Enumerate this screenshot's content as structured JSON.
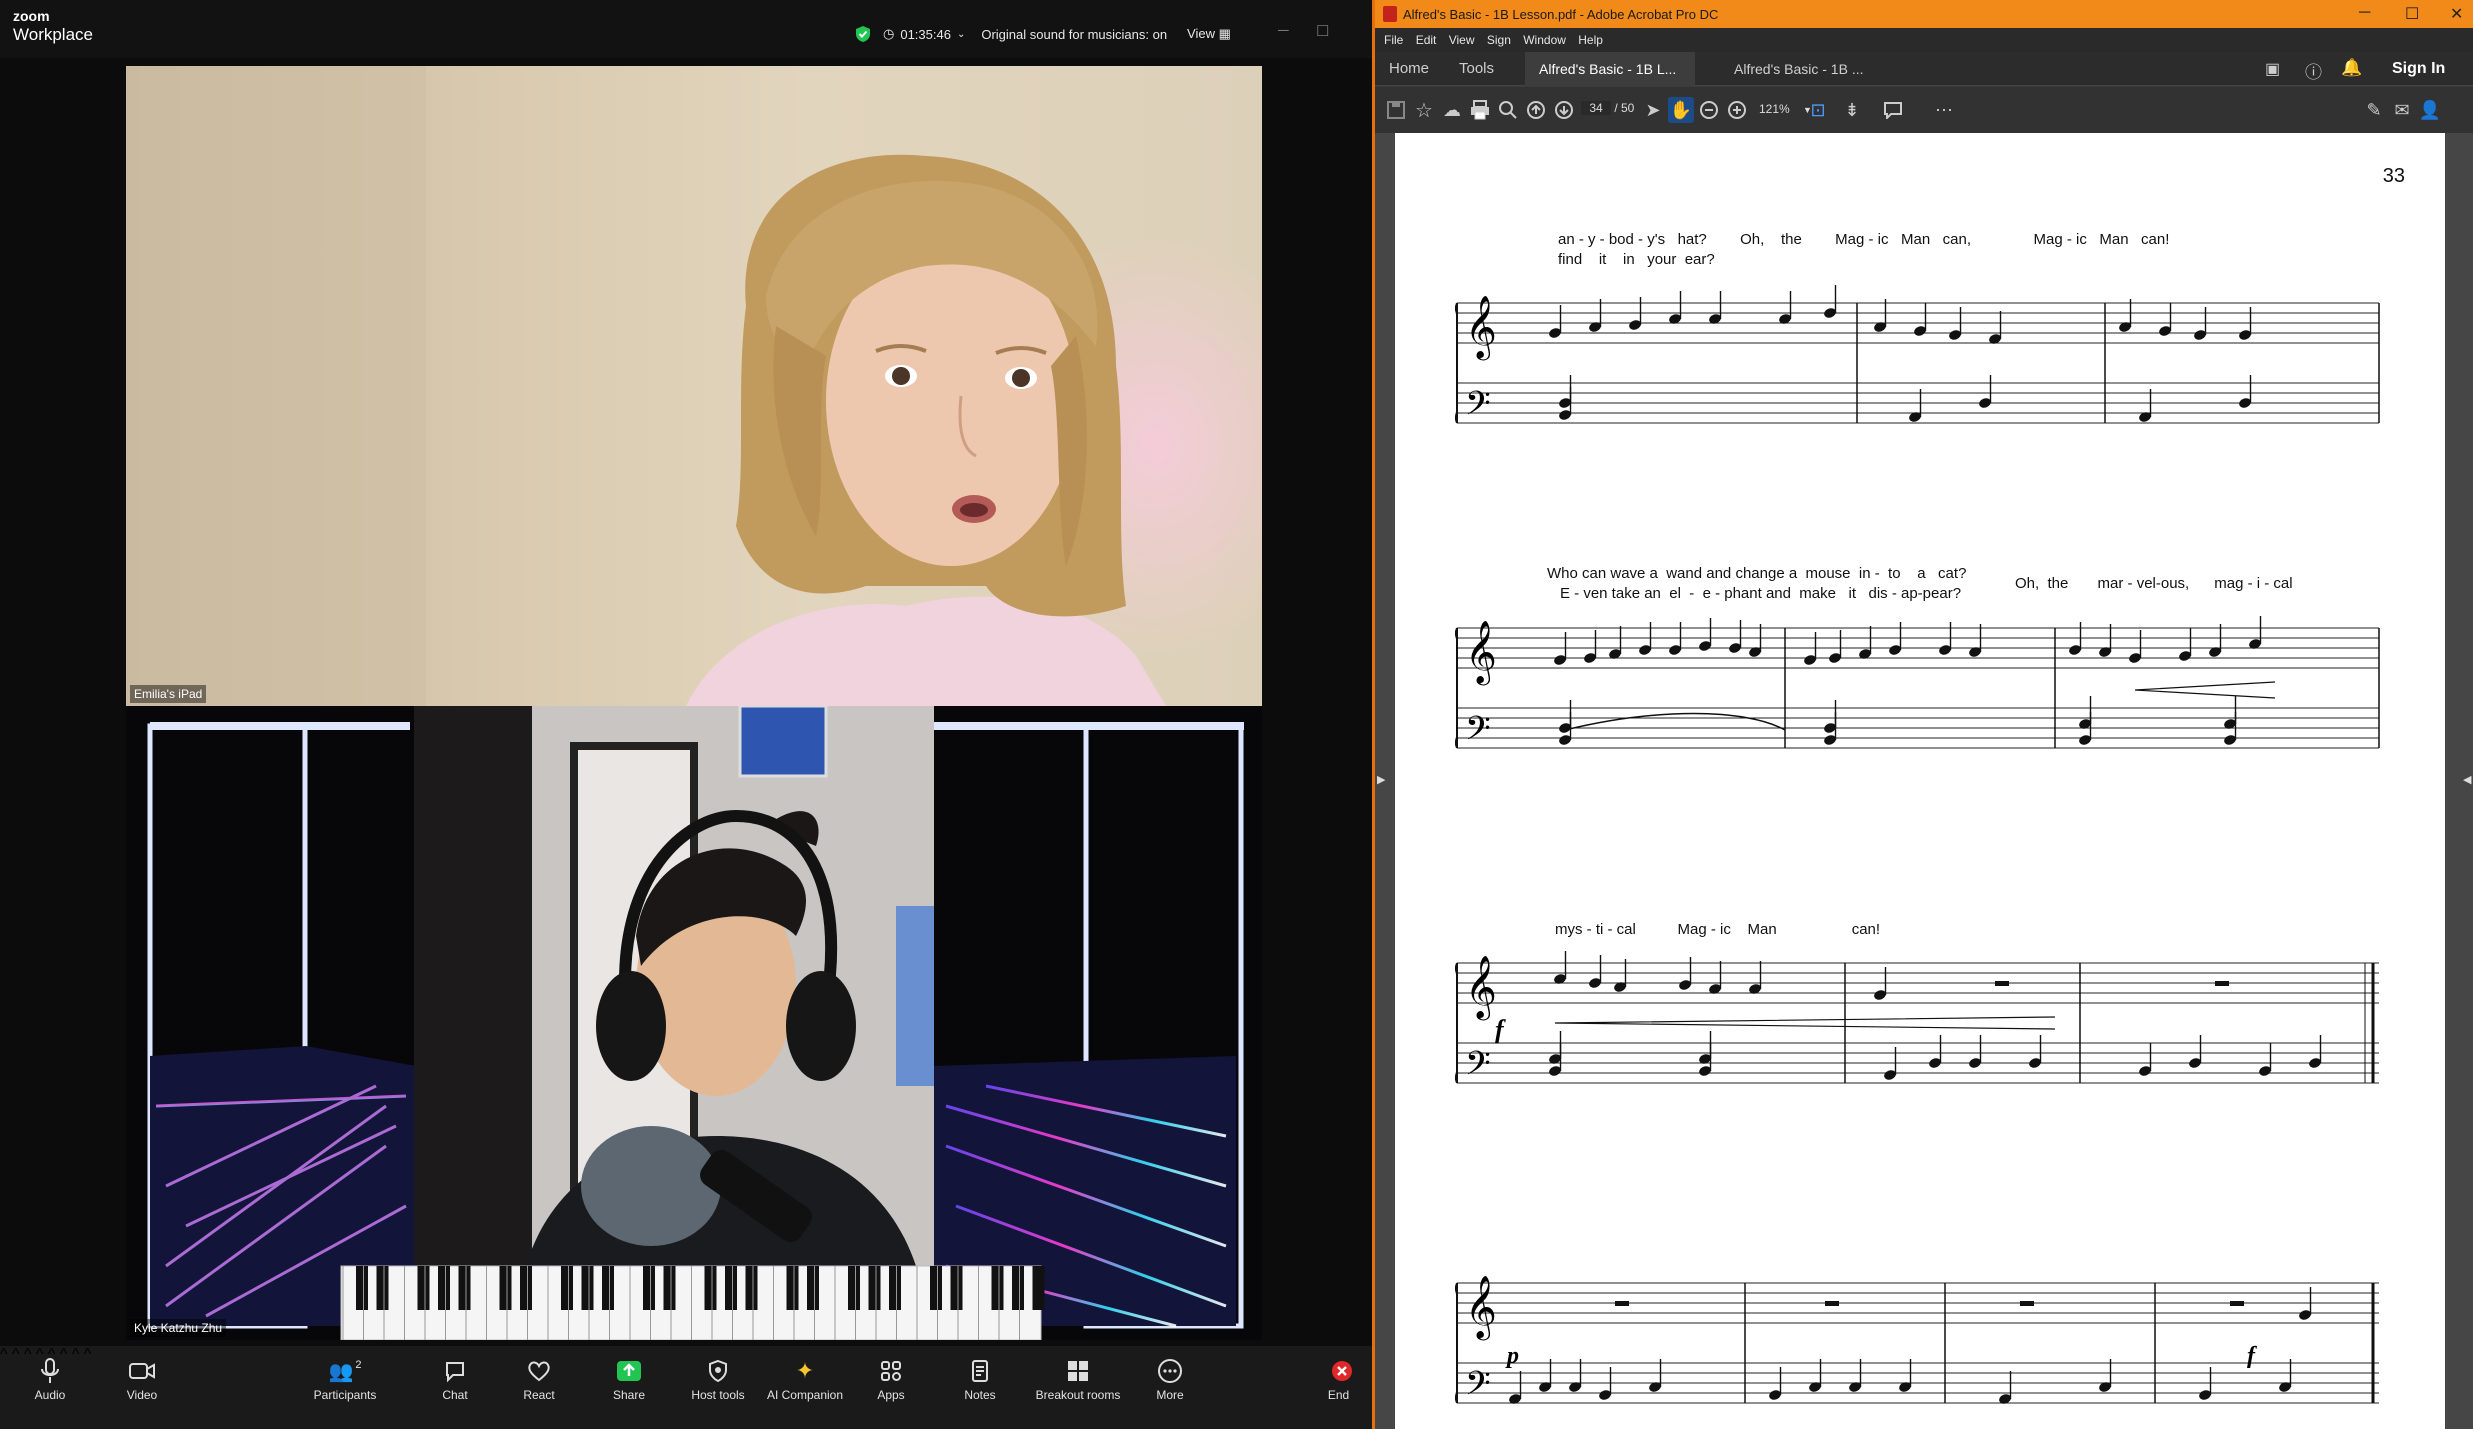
{
  "zoom": {
    "logo_top": "zoom",
    "logo_bottom": "Workplace",
    "timer": "01:35:46",
    "sound_status": "Original sound for musicians: on",
    "view_label": "View",
    "participant_top": "Emilia's iPad",
    "participant_bottom": "Kyle Katzhu Zhu",
    "toolbar": {
      "audio": "Audio",
      "video": "Video",
      "participants": "Participants",
      "participants_count": "2",
      "chat": "Chat",
      "react": "React",
      "share": "Share",
      "host_tools": "Host tools",
      "ai_companion": "AI Companion",
      "apps": "Apps",
      "notes": "Notes",
      "breakout": "Breakout rooms",
      "more": "More",
      "end": "End"
    }
  },
  "acrobat": {
    "window_title": "Alfred's Basic - 1B Lesson.pdf - Adobe Acrobat Pro DC",
    "menu": [
      "File",
      "Edit",
      "View",
      "Sign",
      "Window",
      "Help"
    ],
    "tabs": {
      "home": "Home",
      "tools": "Tools",
      "doc1": "Alfred's Basic - 1B L...",
      "doc2": "Alfred's Basic - 1B ..."
    },
    "sign_in": "Sign In",
    "current_page": "34",
    "page_total": "/ 50",
    "zoom_level": "121%",
    "page": {
      "number": "33",
      "system1_lyric1": "an - y - bod - y's   hat?        Oh,    the        Mag - ic   Man   can,               Mag - ic   Man   can!",
      "system1_lyric2": "find    it    in   your  ear?",
      "system2_lyric1": "Who can wave a  wand and change a  mouse  in -  to    a   cat?",
      "system2_lyric2": "E - ven take an  el  -  e - phant and  make   it   dis - ap-pear?",
      "system2_lyric_right": "Oh,  the       mar - vel-ous,      mag - i - cal",
      "system3_lyric": "mys - ti - cal          Mag - ic    Man                  can!",
      "dyn_f": "f",
      "dyn_p": "p",
      "dyn_f2": "f"
    }
  }
}
